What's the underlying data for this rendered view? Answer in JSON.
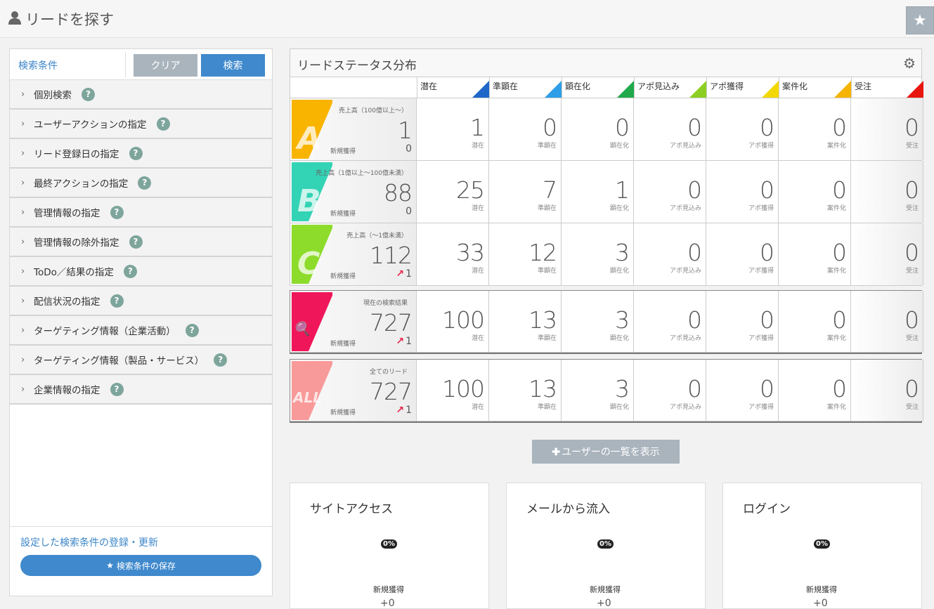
{
  "header": {
    "title": "リードを探す"
  },
  "search_panel": {
    "label": "検索条件",
    "clear_label": "クリア",
    "search_label": "検索",
    "items": [
      {
        "label": "個別検索"
      },
      {
        "label": "ユーザーアクションの指定"
      },
      {
        "label": "リード登録日の指定"
      },
      {
        "label": "最終アクションの指定"
      },
      {
        "label": "管理情報の指定"
      },
      {
        "label": "管理情報の除外指定"
      },
      {
        "label": "ToDo／結果の指定"
      },
      {
        "label": "配信状況の指定"
      },
      {
        "label": "ターゲティング情報（企業活動）"
      },
      {
        "label": "ターゲティング情報（製品・サービス）"
      },
      {
        "label": "企業情報の指定"
      }
    ],
    "register_label": "設定した検索条件の登録・更新",
    "save_label": "検索条件の保存"
  },
  "distribution": {
    "title": "リードステータス分布",
    "columns": [
      {
        "label": "潜在",
        "color": "#1f66c9"
      },
      {
        "label": "準顕在",
        "color": "#2e9ee8"
      },
      {
        "label": "顕在化",
        "color": "#22a94b"
      },
      {
        "label": "アポ見込み",
        "color": "#8ccf22"
      },
      {
        "label": "アポ獲得",
        "color": "#f2d800"
      },
      {
        "label": "案件化",
        "color": "#f6b400"
      },
      {
        "label": "受注",
        "color": "#e8150e"
      }
    ],
    "rows": [
      {
        "letter": "A",
        "color": "#f9b400",
        "sales": "売上高（100億以上～）",
        "total": "1",
        "new_label": "新規獲得",
        "new": "0",
        "new_arrow": "",
        "values": [
          "1",
          "0",
          "0",
          "0",
          "0",
          "0",
          "0"
        ]
      },
      {
        "letter": "B",
        "color": "#33d3b5",
        "sales": "売上高（1億以上～100億未満）",
        "total": "88",
        "new_label": "新規獲得",
        "new": "0",
        "new_arrow": "",
        "values": [
          "25",
          "7",
          "1",
          "0",
          "0",
          "0",
          "0"
        ]
      },
      {
        "letter": "C",
        "color": "#8ddc2b",
        "sales": "売上高（～1億未満）",
        "total": "112",
        "new_label": "新規獲得",
        "new": "1",
        "new_arrow": "↗",
        "values": [
          "33",
          "12",
          "3",
          "0",
          "0",
          "0",
          "0"
        ]
      }
    ],
    "summaries": [
      {
        "letter": "🔍",
        "color": "#f0165a",
        "sales": "現在の検索結果",
        "total": "727",
        "new_label": "新規獲得",
        "new": "1",
        "new_arrow": "↗",
        "values": [
          "100",
          "13",
          "3",
          "0",
          "0",
          "0",
          "0"
        ]
      },
      {
        "letter": "ALL",
        "color": "#f99a9a",
        "sales": "全てのリード",
        "total": "727",
        "new_label": "新規獲得",
        "new": "1",
        "new_arrow": "↗",
        "values": [
          "100",
          "13",
          "3",
          "0",
          "0",
          "0",
          "0"
        ]
      }
    ]
  },
  "show_users_label": "ユーザーの一覧を表示",
  "cards": [
    {
      "title": "サイトアクセス",
      "pct": "0%",
      "new_label": "新規獲得",
      "new_value": "+0"
    },
    {
      "title": "メールから流入",
      "pct": "0%",
      "new_label": "新規獲得",
      "new_value": "+0"
    },
    {
      "title": "ログイン",
      "pct": "0%",
      "new_label": "新規獲得",
      "new_value": "+0"
    }
  ]
}
